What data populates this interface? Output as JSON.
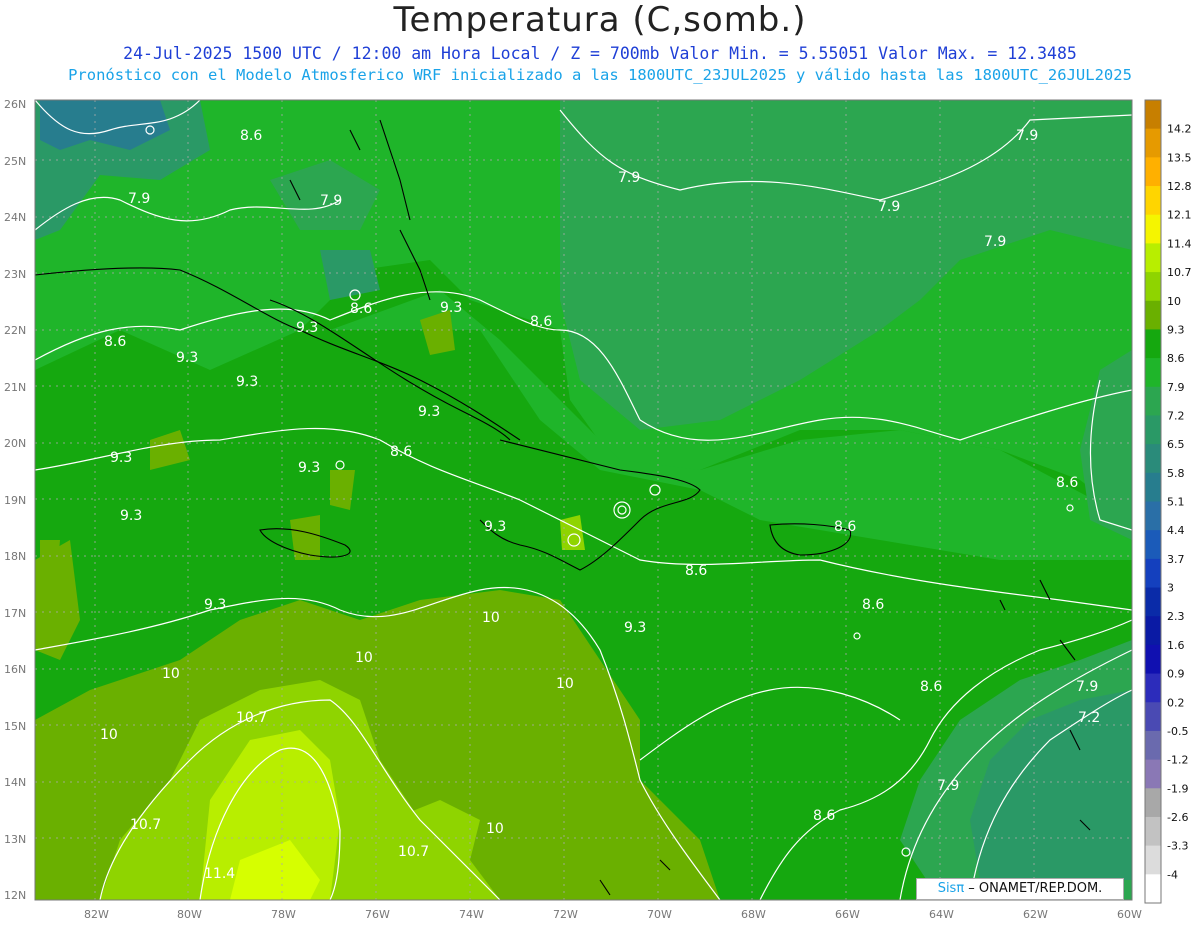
{
  "header": {
    "title": "Temperatura (C,somb.)",
    "line1": "24-Jul-2025  1500 UTC / 12:00 am Hora Local / Z = 700mb   Valor Min. = 5.55051  Valor Max. = 12.3485",
    "line2": "Pronóstico con el Modelo Atmosferico WRF inicializado a las 1800UTC_23JUL2025 y válido hasta las  1800UTC_26JUL2025"
  },
  "axes": {
    "lat_labels": [
      "26N",
      "25N",
      "24N",
      "23N",
      "22N",
      "21N",
      "20N",
      "19N",
      "18N",
      "17N",
      "16N",
      "15N",
      "14N",
      "13N",
      "12N"
    ],
    "lon_labels": [
      "82W",
      "80W",
      "78W",
      "76W",
      "74W",
      "72W",
      "70W",
      "68W",
      "66W",
      "64W",
      "62W",
      "60W"
    ]
  },
  "colorbar": {
    "labels": [
      "14.2",
      "13.5",
      "12.8",
      "12.1",
      "11.4",
      "10.7",
      "10",
      "9.3",
      "8.6",
      "7.9",
      "7.2",
      "6.5",
      "5.8",
      "5.1",
      "4.4",
      "3.7",
      "3",
      "2.3",
      "1.6",
      "0.9",
      "0.2",
      "-0.5",
      "-1.2",
      "-1.9",
      "-2.6",
      "-3.3",
      "-4"
    ],
    "colors": [
      "#c77f00",
      "#e69a00",
      "#ffb000",
      "#ffd500",
      "#f5f500",
      "#b8ee00",
      "#8fd400",
      "#6ab000",
      "#15a80f",
      "#1fb52a",
      "#2ca650",
      "#2a9966",
      "#2a8b7a",
      "#277d8e",
      "#2a6fa7",
      "#1b5bb9",
      "#1440be",
      "#0a2ba8",
      "#0a1aa4",
      "#1010b0",
      "#2c2cbb",
      "#4a4ab3",
      "#6a6aae",
      "#8a78b5",
      "#a8a8a8",
      "#c2c2c2",
      "#dcdcdc",
      "#ffffff"
    ]
  },
  "contour_labels": [
    "8.6",
    "7.9",
    "7.9",
    "7.9",
    "7.9",
    "7.9",
    "7.9",
    "8.6",
    "9.3",
    "8.6",
    "9.3",
    "9.3",
    "9.3",
    "9.3",
    "8.6",
    "9.3",
    "9.3",
    "9.3",
    "8.6",
    "9.3",
    "8.6",
    "8.6",
    "8.6",
    "9.3",
    "9.3",
    "8.6",
    "10",
    "10",
    "10",
    "10.7",
    "10",
    "10.7",
    "10.7",
    "10",
    "11.4",
    "10",
    "8.6",
    "7.9",
    "7.2",
    "7.9",
    "8.6"
  ],
  "credit": {
    "logo": "Sisπ",
    "org": " – ONAMET/REP.DOM."
  }
}
